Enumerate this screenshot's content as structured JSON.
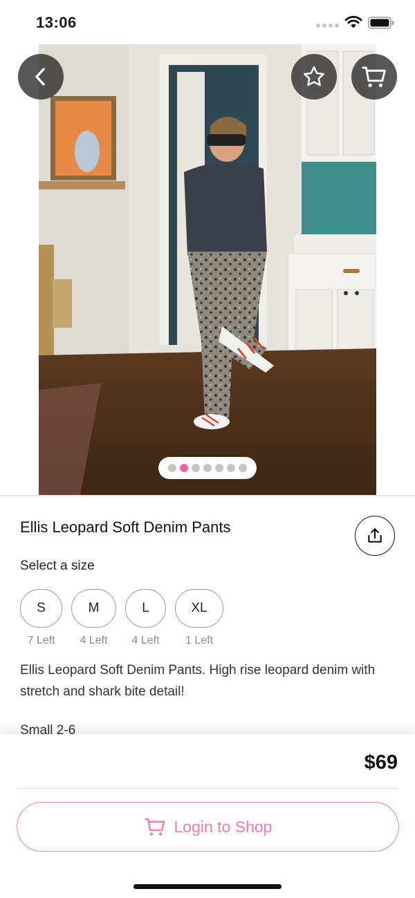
{
  "status_bar": {
    "time": "13:06"
  },
  "top_nav": {
    "back_icon": "chevron-left-icon",
    "favorite_icon": "star-icon",
    "cart_icon": "cart-icon"
  },
  "gallery": {
    "image_count": 7,
    "active_index": 1
  },
  "product": {
    "title": "Ellis Leopard Soft Denim Pants",
    "share_icon": "share-icon",
    "select_size_label": "Select a size",
    "sizes": [
      {
        "label": "S",
        "stock": "7 Left"
      },
      {
        "label": "M",
        "stock": "4 Left"
      },
      {
        "label": "L",
        "stock": "4 Left"
      },
      {
        "label": "XL",
        "stock": "1 Left"
      }
    ],
    "description": "Ellis Leopard Soft Denim Pants. High rise leopard denim with stretch and shark bite detail!",
    "extra_line": "Small 2-6"
  },
  "checkout": {
    "price": "$69",
    "login_label": "Login to Shop",
    "login_icon": "cart-icon"
  },
  "colors": {
    "accent_pink": "#f07cad",
    "pager_active": "#f062a0",
    "overlay_button": "#282828"
  }
}
